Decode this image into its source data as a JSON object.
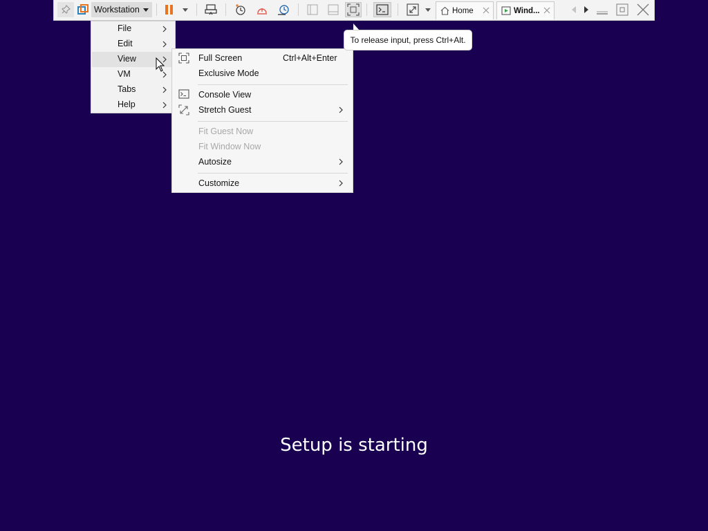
{
  "toolbar": {
    "app_menu_label": "Workstation",
    "tabs": [
      {
        "label": "Home"
      },
      {
        "label": "Wind..."
      }
    ]
  },
  "main_menu": {
    "items": [
      {
        "label": "File"
      },
      {
        "label": "Edit"
      },
      {
        "label": "View"
      },
      {
        "label": "VM"
      },
      {
        "label": "Tabs"
      },
      {
        "label": "Help"
      }
    ],
    "hovered": "View"
  },
  "view_menu": {
    "full_screen": {
      "label": "Full Screen",
      "shortcut": "Ctrl+Alt+Enter"
    },
    "exclusive_mode": {
      "label": "Exclusive Mode"
    },
    "console_view": {
      "label": "Console View"
    },
    "stretch_guest": {
      "label": "Stretch Guest"
    },
    "fit_guest_now": {
      "label": "Fit Guest Now",
      "enabled": false
    },
    "fit_window_now": {
      "label": "Fit Window Now",
      "enabled": false
    },
    "autosize": {
      "label": "Autosize"
    },
    "customize": {
      "label": "Customize"
    }
  },
  "tooltip": {
    "text": "To release input, press Ctrl+Alt."
  },
  "guest": {
    "status_text": "Setup is starting"
  },
  "colors": {
    "guest_background": "#1a0050",
    "pause_accent": "#e8741f",
    "snapshot_revert_accent": "#e2554a",
    "snapshot_manager_accent": "#2a6fb5"
  },
  "icons": {
    "pin": "pin-icon",
    "workstation": "workstation-logo-icon",
    "pause": "pause-icon",
    "send_keys": "send-ctrl-alt-del-icon",
    "snapshot_take": "snapshot-take-icon",
    "snapshot_revert": "snapshot-revert-icon",
    "snapshot_manager": "snapshot-manager-icon",
    "library": "library-view-icon",
    "thumbnail": "thumbnail-bar-icon",
    "full_screen": "full-screen-icon",
    "console": "console-view-icon",
    "stretch": "stretch-guest-icon",
    "home": "home-icon",
    "vm_tab": "vm-running-icon",
    "close": "close-icon",
    "minimize": "minimize-icon",
    "restore": "restore-icon"
  }
}
